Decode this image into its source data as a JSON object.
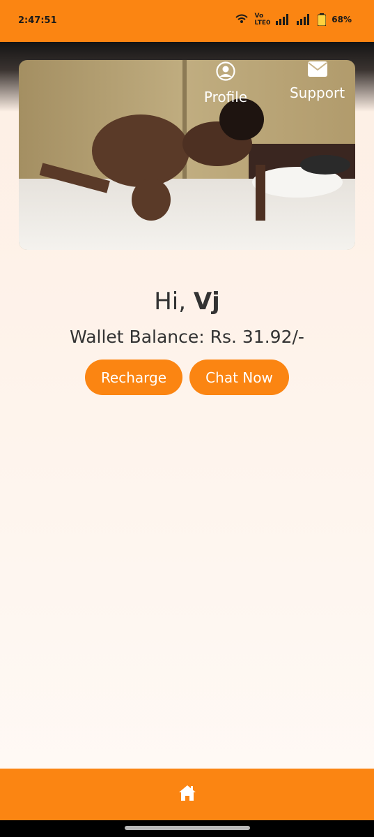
{
  "status_bar": {
    "time": "2:47:51",
    "network_label_top": "Vo",
    "network_label_bottom": "LTE0",
    "battery": "68%"
  },
  "nav": {
    "profile_label": "Profile",
    "support_label": "Support"
  },
  "greeting": {
    "prefix": "Hi,",
    "name": "Vj"
  },
  "wallet": {
    "text": "Wallet Balance: Rs. 31.92/-"
  },
  "actions": {
    "recharge_label": "Recharge",
    "chat_label": "Chat Now"
  },
  "bottom_nav": {
    "icon": "home-icon"
  },
  "colors": {
    "accent": "#fb8512",
    "text": "#333333"
  }
}
